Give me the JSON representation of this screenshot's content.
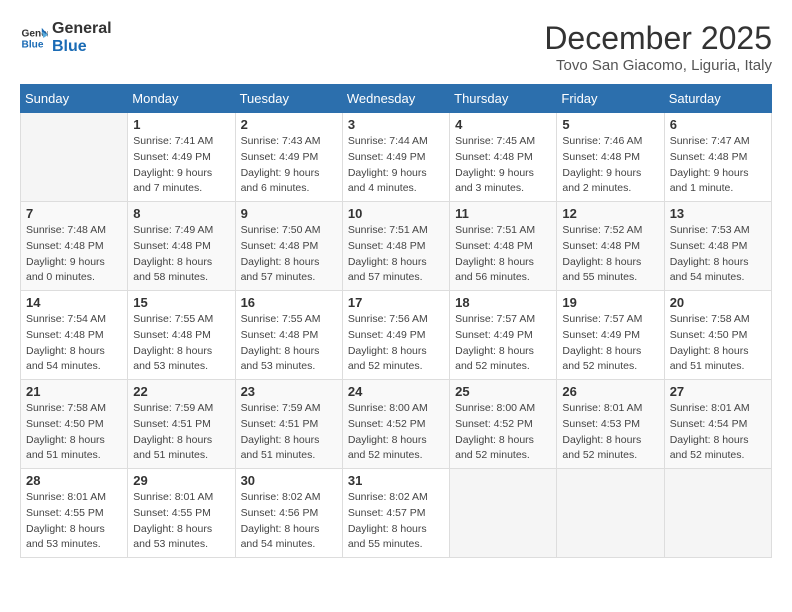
{
  "logo": {
    "line1": "General",
    "line2": "Blue"
  },
  "title": "December 2025",
  "subtitle": "Tovo San Giacomo, Liguria, Italy",
  "days_header": [
    "Sunday",
    "Monday",
    "Tuesday",
    "Wednesday",
    "Thursday",
    "Friday",
    "Saturday"
  ],
  "weeks": [
    [
      {
        "day": "",
        "info": ""
      },
      {
        "day": "1",
        "info": "Sunrise: 7:41 AM\nSunset: 4:49 PM\nDaylight: 9 hours\nand 7 minutes."
      },
      {
        "day": "2",
        "info": "Sunrise: 7:43 AM\nSunset: 4:49 PM\nDaylight: 9 hours\nand 6 minutes."
      },
      {
        "day": "3",
        "info": "Sunrise: 7:44 AM\nSunset: 4:49 PM\nDaylight: 9 hours\nand 4 minutes."
      },
      {
        "day": "4",
        "info": "Sunrise: 7:45 AM\nSunset: 4:48 PM\nDaylight: 9 hours\nand 3 minutes."
      },
      {
        "day": "5",
        "info": "Sunrise: 7:46 AM\nSunset: 4:48 PM\nDaylight: 9 hours\nand 2 minutes."
      },
      {
        "day": "6",
        "info": "Sunrise: 7:47 AM\nSunset: 4:48 PM\nDaylight: 9 hours\nand 1 minute."
      }
    ],
    [
      {
        "day": "7",
        "info": "Sunrise: 7:48 AM\nSunset: 4:48 PM\nDaylight: 9 hours\nand 0 minutes."
      },
      {
        "day": "8",
        "info": "Sunrise: 7:49 AM\nSunset: 4:48 PM\nDaylight: 8 hours\nand 58 minutes."
      },
      {
        "day": "9",
        "info": "Sunrise: 7:50 AM\nSunset: 4:48 PM\nDaylight: 8 hours\nand 57 minutes."
      },
      {
        "day": "10",
        "info": "Sunrise: 7:51 AM\nSunset: 4:48 PM\nDaylight: 8 hours\nand 57 minutes."
      },
      {
        "day": "11",
        "info": "Sunrise: 7:51 AM\nSunset: 4:48 PM\nDaylight: 8 hours\nand 56 minutes."
      },
      {
        "day": "12",
        "info": "Sunrise: 7:52 AM\nSunset: 4:48 PM\nDaylight: 8 hours\nand 55 minutes."
      },
      {
        "day": "13",
        "info": "Sunrise: 7:53 AM\nSunset: 4:48 PM\nDaylight: 8 hours\nand 54 minutes."
      }
    ],
    [
      {
        "day": "14",
        "info": "Sunrise: 7:54 AM\nSunset: 4:48 PM\nDaylight: 8 hours\nand 54 minutes."
      },
      {
        "day": "15",
        "info": "Sunrise: 7:55 AM\nSunset: 4:48 PM\nDaylight: 8 hours\nand 53 minutes."
      },
      {
        "day": "16",
        "info": "Sunrise: 7:55 AM\nSunset: 4:48 PM\nDaylight: 8 hours\nand 53 minutes."
      },
      {
        "day": "17",
        "info": "Sunrise: 7:56 AM\nSunset: 4:49 PM\nDaylight: 8 hours\nand 52 minutes."
      },
      {
        "day": "18",
        "info": "Sunrise: 7:57 AM\nSunset: 4:49 PM\nDaylight: 8 hours\nand 52 minutes."
      },
      {
        "day": "19",
        "info": "Sunrise: 7:57 AM\nSunset: 4:49 PM\nDaylight: 8 hours\nand 52 minutes."
      },
      {
        "day": "20",
        "info": "Sunrise: 7:58 AM\nSunset: 4:50 PM\nDaylight: 8 hours\nand 51 minutes."
      }
    ],
    [
      {
        "day": "21",
        "info": "Sunrise: 7:58 AM\nSunset: 4:50 PM\nDaylight: 8 hours\nand 51 minutes."
      },
      {
        "day": "22",
        "info": "Sunrise: 7:59 AM\nSunset: 4:51 PM\nDaylight: 8 hours\nand 51 minutes."
      },
      {
        "day": "23",
        "info": "Sunrise: 7:59 AM\nSunset: 4:51 PM\nDaylight: 8 hours\nand 51 minutes."
      },
      {
        "day": "24",
        "info": "Sunrise: 8:00 AM\nSunset: 4:52 PM\nDaylight: 8 hours\nand 52 minutes."
      },
      {
        "day": "25",
        "info": "Sunrise: 8:00 AM\nSunset: 4:52 PM\nDaylight: 8 hours\nand 52 minutes."
      },
      {
        "day": "26",
        "info": "Sunrise: 8:01 AM\nSunset: 4:53 PM\nDaylight: 8 hours\nand 52 minutes."
      },
      {
        "day": "27",
        "info": "Sunrise: 8:01 AM\nSunset: 4:54 PM\nDaylight: 8 hours\nand 52 minutes."
      }
    ],
    [
      {
        "day": "28",
        "info": "Sunrise: 8:01 AM\nSunset: 4:55 PM\nDaylight: 8 hours\nand 53 minutes."
      },
      {
        "day": "29",
        "info": "Sunrise: 8:01 AM\nSunset: 4:55 PM\nDaylight: 8 hours\nand 53 minutes."
      },
      {
        "day": "30",
        "info": "Sunrise: 8:02 AM\nSunset: 4:56 PM\nDaylight: 8 hours\nand 54 minutes."
      },
      {
        "day": "31",
        "info": "Sunrise: 8:02 AM\nSunset: 4:57 PM\nDaylight: 8 hours\nand 55 minutes."
      },
      {
        "day": "",
        "info": ""
      },
      {
        "day": "",
        "info": ""
      },
      {
        "day": "",
        "info": ""
      }
    ]
  ]
}
